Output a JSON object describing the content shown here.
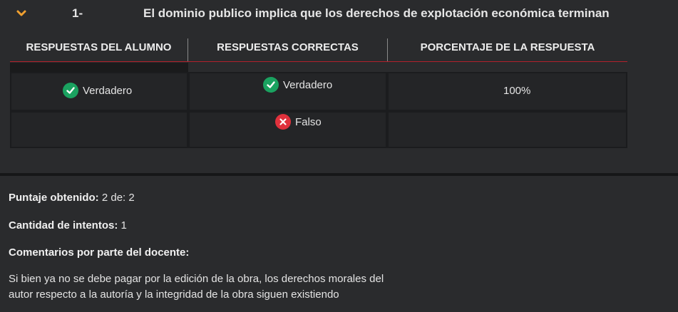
{
  "question": {
    "number": "1-",
    "title": "El dominio publico implica que los derechos de explotación económica terminan"
  },
  "table": {
    "headers": {
      "student": "RESPUESTAS DEL ALUMNO",
      "correct": "RESPUESTAS CORRECTAS",
      "percent": "PORCENTAJE DE LA RESPUESTA"
    },
    "rows": [
      {
        "student": "Verdadero",
        "student_icon": "check-circle-icon",
        "correct": "Verdadero",
        "correct_icon": "check-circle-icon",
        "percent": "100%"
      },
      {
        "student": "",
        "correct": "Falso",
        "correct_icon": "x-circle-icon",
        "percent": ""
      }
    ]
  },
  "summary": {
    "score_label": "Puntaje obtenido:",
    "score_value": "2 de: 2",
    "attempts_label": "Cantidad de intentos:",
    "attempts_value": "1",
    "comments_label": "Comentarios por parte del docente:",
    "comment_line1": "Si bien ya no se debe pagar por la edición de la obra, los derechos morales del",
    "comment_line2": "autor respecto a la autoría y la integridad de la obra siguen existiendo"
  },
  "colors": {
    "accent": "#f0a030",
    "success": "#1aa260",
    "error": "#e0313c",
    "header_line": "#b3212b"
  }
}
